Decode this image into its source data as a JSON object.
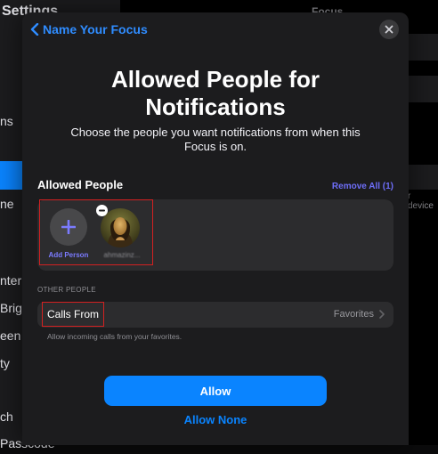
{
  "background": {
    "sidebar_title": "Settings",
    "sidebar_rows": [
      "ns",
      "ne",
      "nter",
      "Brigh",
      "een &",
      "ty",
      "ch",
      "Passcode"
    ],
    "main_title": "Focus",
    "main_text": "r device"
  },
  "sheet": {
    "back_label": "Name Your Focus",
    "title": "Allowed People for Notifications",
    "subtitle": "Choose the people you want notifications from when this Focus is on.",
    "allowed_people": {
      "heading": "Allowed People",
      "remove_all": "Remove All (1)",
      "add_label": "Add Person",
      "person_name": "ahmazinz..."
    },
    "other_people": {
      "heading": "OTHER PEOPLE",
      "calls_label": "Calls From",
      "calls_value": "Favorites",
      "calls_footer": "Allow incoming calls from your favorites."
    },
    "allow_label": "Allow",
    "allow_none_label": "Allow None"
  },
  "colors": {
    "accent": "#0a84ff",
    "secondary_accent": "#6e6ef8",
    "highlight_box": "#d32121",
    "sheet_bg": "#1c1c1e",
    "card_bg": "#2c2c2e"
  }
}
